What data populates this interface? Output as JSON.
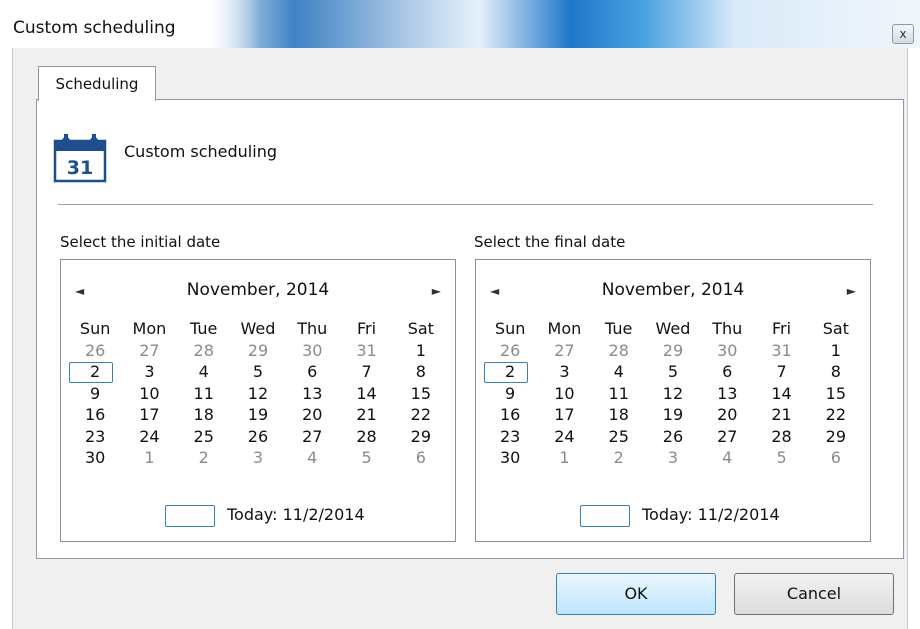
{
  "window": {
    "title": "Custom scheduling",
    "close_glyph": "x"
  },
  "tabs": [
    {
      "label": "Scheduling",
      "active": true
    }
  ],
  "header": {
    "icon": "calendar-icon",
    "icon_day": "31",
    "text": "Custom scheduling"
  },
  "initial_date": {
    "label": "Select the initial date",
    "calendar": {
      "month_label": "November, 2014",
      "prev_glyph": "◄",
      "next_glyph": "►",
      "weekdays": [
        "Sun",
        "Mon",
        "Tue",
        "Wed",
        "Thu",
        "Fri",
        "Sat"
      ],
      "weeks": [
        [
          "26",
          "27",
          "28",
          "29",
          "30",
          "31",
          "1"
        ],
        [
          "2",
          "3",
          "4",
          "5",
          "6",
          "7",
          "8"
        ],
        [
          "9",
          "10",
          "11",
          "12",
          "13",
          "14",
          "15"
        ],
        [
          "16",
          "17",
          "18",
          "19",
          "20",
          "21",
          "22"
        ],
        [
          "23",
          "24",
          "25",
          "26",
          "27",
          "28",
          "29"
        ],
        [
          "30",
          "1",
          "2",
          "3",
          "4",
          "5",
          "6"
        ]
      ],
      "selected_day": "2",
      "today_label": "Today: 11/2/2014"
    }
  },
  "final_date": {
    "label": "Select the final date",
    "calendar": {
      "month_label": "November, 2014",
      "prev_glyph": "◄",
      "next_glyph": "►",
      "weekdays": [
        "Sun",
        "Mon",
        "Tue",
        "Wed",
        "Thu",
        "Fri",
        "Sat"
      ],
      "weeks": [
        [
          "26",
          "27",
          "28",
          "29",
          "30",
          "31",
          "1"
        ],
        [
          "2",
          "3",
          "4",
          "5",
          "6",
          "7",
          "8"
        ],
        [
          "9",
          "10",
          "11",
          "12",
          "13",
          "14",
          "15"
        ],
        [
          "16",
          "17",
          "18",
          "19",
          "20",
          "21",
          "22"
        ],
        [
          "23",
          "24",
          "25",
          "26",
          "27",
          "28",
          "29"
        ],
        [
          "30",
          "1",
          "2",
          "3",
          "4",
          "5",
          "6"
        ]
      ],
      "selected_day": "2",
      "today_label": "Today: 11/2/2014"
    }
  },
  "buttons": {
    "ok": "OK",
    "cancel": "Cancel"
  },
  "colors": {
    "accent": "#3c7fb1",
    "icon_blue": "#1e4f8c",
    "other_month_text": "#8b8b8b"
  }
}
